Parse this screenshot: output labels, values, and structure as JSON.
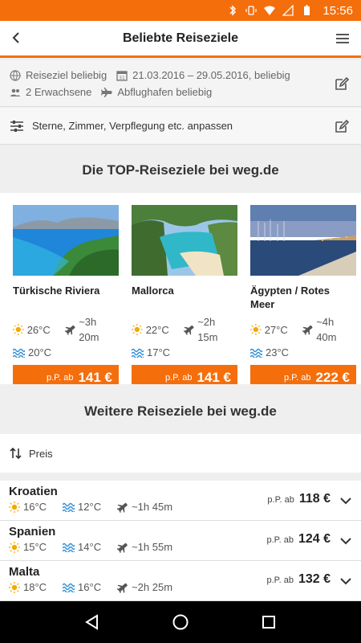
{
  "status_bar": {
    "time": "15:56",
    "battery_icon": "battery-icon",
    "wifi_icon": "wifi-icon",
    "bluetooth_icon": "bluetooth-icon",
    "vibrate_icon": "vibrate-icon"
  },
  "header": {
    "title": "Beliebte Reiseziele"
  },
  "search": {
    "destination": "Reiseziel beliebig",
    "dates": "21.03.2016 – 29.05.2016, beliebig",
    "travelers": "2 Erwachsene",
    "airport": "Abflughafen beliebig"
  },
  "filter": {
    "label": "Sterne, Zimmer, Verpflegung etc. anpassen"
  },
  "top_section": {
    "title": "Die TOP-Reiseziele bei weg.de"
  },
  "top_destinations": [
    {
      "name": "Türkische Riviera",
      "air_temp": "26°C",
      "flight": "~3h 20m",
      "water_temp": "20°C",
      "price_prefix": "p.P. ab",
      "price": "141 €"
    },
    {
      "name": "Mallorca",
      "air_temp": "22°C",
      "flight": "~2h 15m",
      "water_temp": "17°C",
      "price_prefix": "p.P. ab",
      "price": "141 €"
    },
    {
      "name": "Ägypten / Rotes Meer",
      "air_temp": "27°C",
      "flight": "~4h 40m",
      "water_temp": "23°C",
      "price_prefix": "p.P. ab",
      "price": "222 €"
    }
  ],
  "more_section": {
    "title": "Weitere Reiseziele bei weg.de"
  },
  "sort": {
    "label": "Preis"
  },
  "destinations": [
    {
      "name": "Kroatien",
      "air_temp": "16°C",
      "water_temp": "12°C",
      "flight": "~1h 45m",
      "price_prefix": "p.P. ab",
      "price": "118 €"
    },
    {
      "name": "Spanien",
      "air_temp": "15°C",
      "water_temp": "14°C",
      "flight": "~1h 55m",
      "price_prefix": "p.P. ab",
      "price": "124 €"
    },
    {
      "name": "Malta",
      "air_temp": "18°C",
      "water_temp": "16°C",
      "flight": "~2h 25m",
      "price_prefix": "p.P. ab",
      "price": "132 €"
    }
  ],
  "colors": {
    "brand": "#f56e0c",
    "sun": "#f5a800",
    "water": "#2f8fd6"
  }
}
